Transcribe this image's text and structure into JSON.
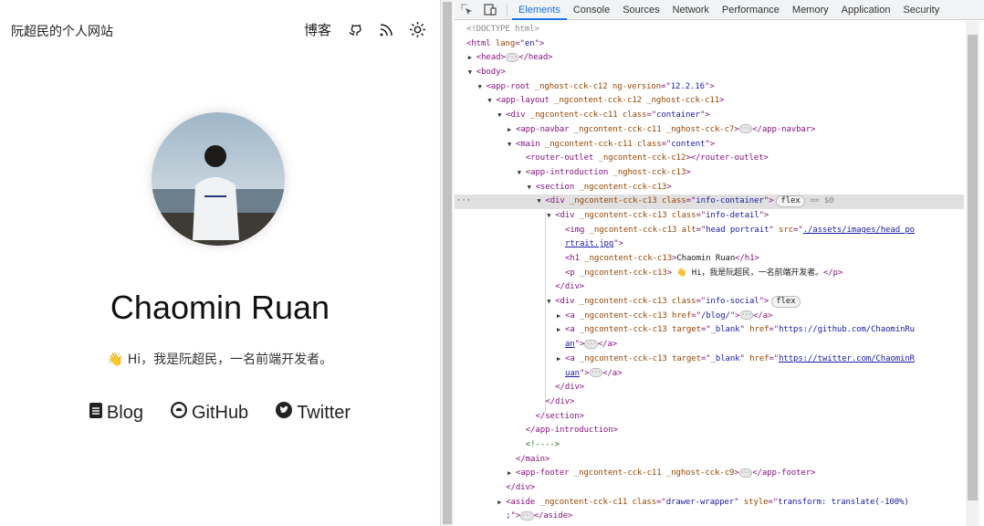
{
  "site": {
    "brand": "阮超民的个人网站",
    "nav": {
      "blog": "博客",
      "icons": [
        "github-icon",
        "rss-icon",
        "sun-icon"
      ]
    },
    "name": "Chaomin Ruan",
    "intro": "👋 Hi，我是阮超民，一名前端开发者。",
    "social": [
      {
        "label": "Blog",
        "icon": "document-icon"
      },
      {
        "label": "GitHub",
        "icon": "github-icon"
      },
      {
        "label": "Twitter",
        "icon": "twitter-icon"
      }
    ]
  },
  "devtools": {
    "tabs": [
      "Elements",
      "Console",
      "Sources",
      "Network",
      "Performance",
      "Memory",
      "Application",
      "Security"
    ],
    "active_tab": "Elements",
    "lines": [
      {
        "lvl": 0,
        "s": [
          [
            "gray",
            "<!DOCTYPE html>"
          ]
        ]
      },
      {
        "lvl": 0,
        "s": [
          [
            "tag",
            "<html "
          ],
          [
            "attr",
            "lang"
          ],
          [
            "tag",
            "=\""
          ],
          [
            "val",
            "en"
          ],
          [
            "tag",
            "\">"
          ]
        ]
      },
      {
        "lvl": 1,
        "a": "▶",
        "s": [
          [
            "tag",
            "<head>"
          ],
          [
            "ell",
            "···"
          ],
          [
            "tag",
            "</head>"
          ]
        ]
      },
      {
        "lvl": 1,
        "a": "▼",
        "s": [
          [
            "tag",
            "<body>"
          ]
        ]
      },
      {
        "lvl": 2,
        "a": "▼",
        "s": [
          [
            "tag",
            "<app-root "
          ],
          [
            "attr",
            "_nghost-cck-c12 ng-version"
          ],
          [
            "tag",
            "=\""
          ],
          [
            "val",
            "12.2.16"
          ],
          [
            "tag",
            "\">"
          ]
        ]
      },
      {
        "lvl": 3,
        "a": "▼",
        "s": [
          [
            "tag",
            "<app-layout "
          ],
          [
            "attr",
            "_ngcontent-cck-c12 _nghost-cck-c11"
          ],
          [
            "tag",
            ">"
          ]
        ]
      },
      {
        "lvl": 4,
        "a": "▼",
        "s": [
          [
            "tag",
            "<div "
          ],
          [
            "attr",
            "_ngcontent-cck-c11 class"
          ],
          [
            "tag",
            "=\""
          ],
          [
            "val",
            "container"
          ],
          [
            "tag",
            "\">"
          ]
        ]
      },
      {
        "lvl": 5,
        "a": "▶",
        "s": [
          [
            "tag",
            "<app-navbar "
          ],
          [
            "attr",
            "_ngcontent-cck-c11 _nghost-cck-c7"
          ],
          [
            "tag",
            ">"
          ],
          [
            "ell",
            "···"
          ],
          [
            "tag",
            "</app-navbar>"
          ]
        ]
      },
      {
        "lvl": 5,
        "a": "▼",
        "s": [
          [
            "tag",
            "<main "
          ],
          [
            "attr",
            "_ngcontent-cck-c11 class"
          ],
          [
            "tag",
            "=\""
          ],
          [
            "val",
            "content"
          ],
          [
            "tag",
            "\">"
          ]
        ]
      },
      {
        "lvl": 6,
        "s": [
          [
            "tag",
            "<router-outlet "
          ],
          [
            "attr",
            "_ngcontent-cck-c12"
          ],
          [
            "tag",
            "></router-outlet>"
          ]
        ]
      },
      {
        "lvl": 6,
        "a": "▼",
        "s": [
          [
            "tag",
            "<app-introduction "
          ],
          [
            "attr",
            "_nghost-cck-c13"
          ],
          [
            "tag",
            ">"
          ]
        ]
      },
      {
        "lvl": 7,
        "a": "▼",
        "s": [
          [
            "tag",
            "<section "
          ],
          [
            "attr",
            "_ngcontent-cck-c13"
          ],
          [
            "tag",
            ">"
          ]
        ]
      },
      {
        "lvl": 8,
        "a": "▼",
        "sel": true,
        "s": [
          [
            "tag",
            "<div "
          ],
          [
            "attr",
            "_ngcontent-cck-c13 class"
          ],
          [
            "tag",
            "=\""
          ],
          [
            "val",
            "info-container"
          ],
          [
            "tag",
            "\">"
          ],
          [
            "badge",
            "flex"
          ],
          [
            "gray",
            " == $0"
          ]
        ]
      },
      {
        "lvl": 9,
        "a": "▼",
        "s": [
          [
            "tag",
            "<div "
          ],
          [
            "attr",
            "_ngcontent-cck-c13 class"
          ],
          [
            "tag",
            "=\""
          ],
          [
            "val",
            "info-detail"
          ],
          [
            "tag",
            "\">"
          ]
        ]
      },
      {
        "lvl": 10,
        "s": [
          [
            "tag",
            "<img "
          ],
          [
            "attr",
            "_ngcontent-cck-c13 alt"
          ],
          [
            "tag",
            "=\""
          ],
          [
            "val",
            "head portrait"
          ],
          [
            "tag",
            "\" "
          ],
          [
            "attr",
            "src"
          ],
          [
            "tag",
            "=\""
          ],
          [
            "link",
            "./assets/images/head_po"
          ]
        ]
      },
      {
        "lvl": 10,
        "s": [
          [
            "link",
            "rtrait.jpg"
          ],
          [
            "tag",
            "\">"
          ]
        ]
      },
      {
        "lvl": 10,
        "s": [
          [
            "tag",
            "<h1 "
          ],
          [
            "attr",
            "_ngcontent-cck-c13"
          ],
          [
            "tag",
            ">"
          ],
          [
            "txt",
            "Chaomin Ruan"
          ],
          [
            "tag",
            "</h1>"
          ]
        ]
      },
      {
        "lvl": 10,
        "s": [
          [
            "tag",
            "<p "
          ],
          [
            "attr",
            "_ngcontent-cck-c13"
          ],
          [
            "tag",
            "> "
          ],
          [
            "txt",
            "👋 Hi，我是阮超民，一名前端开发者。"
          ],
          [
            "tag",
            "</p>"
          ]
        ]
      },
      {
        "lvl": 9,
        "s": [
          [
            "tag",
            "</div>"
          ]
        ]
      },
      {
        "lvl": 9,
        "a": "▼",
        "s": [
          [
            "tag",
            "<div "
          ],
          [
            "attr",
            "_ngcontent-cck-c13 class"
          ],
          [
            "tag",
            "=\""
          ],
          [
            "val",
            "info-social"
          ],
          [
            "tag",
            "\">"
          ],
          [
            "badge",
            "flex"
          ]
        ]
      },
      {
        "lvl": 10,
        "a": "▶",
        "s": [
          [
            "tag",
            "<a "
          ],
          [
            "attr",
            "_ngcontent-cck-c13 href"
          ],
          [
            "tag",
            "=\""
          ],
          [
            "val",
            "/blog/"
          ],
          [
            "tag",
            "\">"
          ],
          [
            "ell",
            "···"
          ],
          [
            "tag",
            "</a>"
          ]
        ]
      },
      {
        "lvl": 10,
        "a": "▶",
        "s": [
          [
            "tag",
            "<a "
          ],
          [
            "attr",
            "_ngcontent-cck-c13 target"
          ],
          [
            "tag",
            "=\""
          ],
          [
            "val",
            "_blank"
          ],
          [
            "tag",
            "\" "
          ],
          [
            "attr",
            "href"
          ],
          [
            "tag",
            "=\""
          ],
          [
            "val",
            "https://github.com/ChaominRu"
          ]
        ]
      },
      {
        "lvl": 10,
        "s": [
          [
            "link",
            "an"
          ],
          [
            "tag",
            "\">"
          ],
          [
            "ell",
            "···"
          ],
          [
            "tag",
            "</a>"
          ]
        ]
      },
      {
        "lvl": 10,
        "a": "▶",
        "s": [
          [
            "tag",
            "<a "
          ],
          [
            "attr",
            "_ngcontent-cck-c13 target"
          ],
          [
            "tag",
            "=\""
          ],
          [
            "val",
            "_blank"
          ],
          [
            "tag",
            "\" "
          ],
          [
            "attr",
            "href"
          ],
          [
            "tag",
            "=\""
          ],
          [
            "link",
            "https://twitter.com/ChaominR"
          ]
        ]
      },
      {
        "lvl": 10,
        "s": [
          [
            "link",
            "uan"
          ],
          [
            "tag",
            "\">"
          ],
          [
            "ell",
            "···"
          ],
          [
            "tag",
            "</a>"
          ]
        ]
      },
      {
        "lvl": 9,
        "s": [
          [
            "tag",
            "</div>"
          ]
        ]
      },
      {
        "lvl": 8,
        "s": [
          [
            "tag",
            "</div>"
          ]
        ]
      },
      {
        "lvl": 7,
        "s": [
          [
            "tag",
            "</section>"
          ]
        ]
      },
      {
        "lvl": 6,
        "s": [
          [
            "tag",
            "</app-introduction>"
          ]
        ]
      },
      {
        "lvl": 6,
        "s": [
          [
            "com",
            "<!---->"
          ]
        ]
      },
      {
        "lvl": 5,
        "s": [
          [
            "tag",
            "</main>"
          ]
        ]
      },
      {
        "lvl": 5,
        "a": "▶",
        "s": [
          [
            "tag",
            "<app-footer "
          ],
          [
            "attr",
            "_ngcontent-cck-c11 _nghost-cck-c9"
          ],
          [
            "tag",
            ">"
          ],
          [
            "ell",
            "···"
          ],
          [
            "tag",
            "</app-footer>"
          ]
        ]
      },
      {
        "lvl": 4,
        "s": [
          [
            "tag",
            "</div>"
          ]
        ]
      },
      {
        "lvl": 4,
        "a": "▶",
        "s": [
          [
            "tag",
            "<aside "
          ],
          [
            "attr",
            "_ngcontent-cck-c11 class"
          ],
          [
            "tag",
            "=\""
          ],
          [
            "val",
            "drawer-wrapper"
          ],
          [
            "tag",
            "\" "
          ],
          [
            "attr",
            "style"
          ],
          [
            "tag",
            "=\""
          ],
          [
            "val",
            "transform: translate(-100%)"
          ]
        ]
      },
      {
        "lvl": 4,
        "s": [
          [
            "val",
            ";"
          ],
          [
            "tag",
            "\">"
          ],
          [
            "ell",
            "···"
          ],
          [
            "tag",
            "</aside>"
          ]
        ]
      }
    ]
  }
}
